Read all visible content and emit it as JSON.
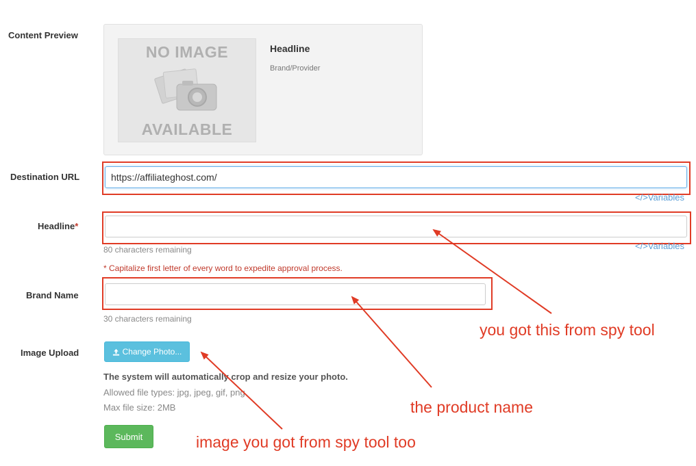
{
  "content_preview": {
    "label": "Content Preview",
    "no_image_top": "NO IMAGE",
    "no_image_bottom": "AVAILABLE",
    "headline": "Headline",
    "brand": "Brand/Provider"
  },
  "destination_url": {
    "label": "Destination URL",
    "value": "https://affiliateghost.com/",
    "variables": "</>Variables"
  },
  "headline_field": {
    "label": "Headline",
    "required_mark": "*",
    "value": "",
    "remaining": "80 characters remaining",
    "variables": "</>Variables",
    "note": "* Capitalize first letter of every word to expedite approval process."
  },
  "brand_name": {
    "label": "Brand Name",
    "value": "",
    "remaining": "30 characters remaining"
  },
  "image_upload": {
    "label": "Image Upload",
    "button": "Change Photo...",
    "note_bold": "The system will automatically crop and resize your photo.",
    "allowed": "Allowed file types: jpg, jpeg, gif, png",
    "max_size": "Max file size: 2MB"
  },
  "submit": "Submit",
  "annotations": {
    "spy_tool": "you got this from spy tool",
    "product_name": "the product name",
    "image_spy": "image you got from spy tool too"
  },
  "colors": {
    "annotation_red": "#e03b25",
    "info_button": "#5bc0de",
    "success_button": "#5cb85c",
    "link_blue": "#5a9ed6"
  }
}
